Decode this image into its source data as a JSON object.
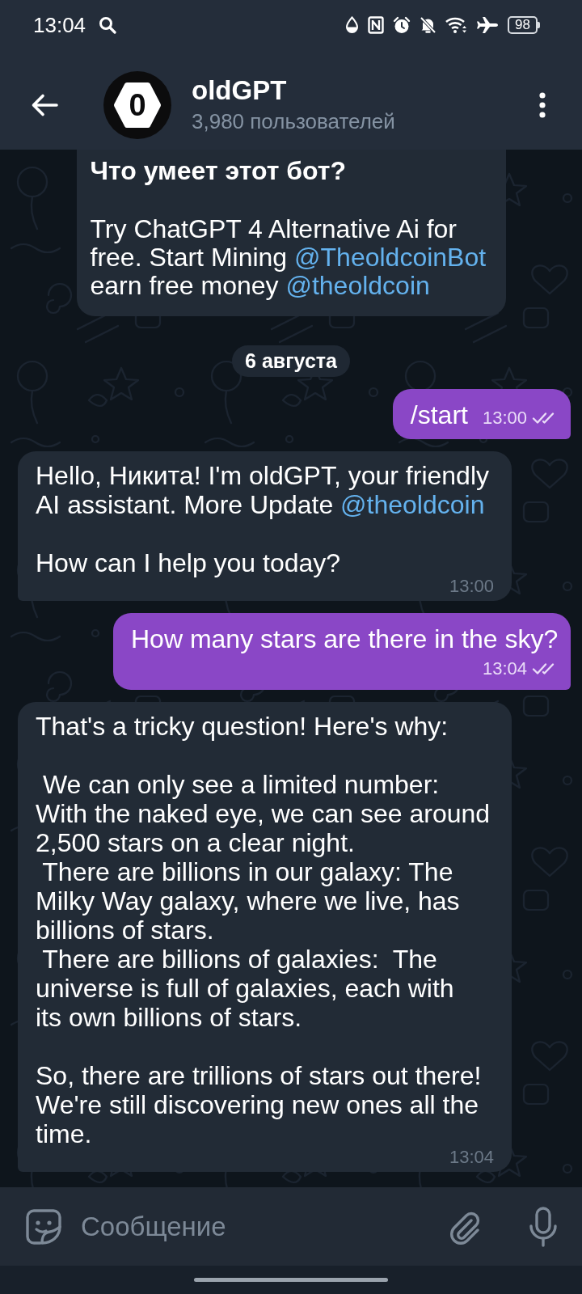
{
  "status_bar": {
    "time": "13:04",
    "battery": "98"
  },
  "header": {
    "logo_text": "0",
    "title": "oldGPT",
    "subtitle": "3,980 пользователей"
  },
  "bot_info": {
    "title": "Что умеет этот бот?",
    "parts": [
      {
        "kind": "text",
        "text": "Try ChatGPT 4 Alternative Ai for\nfree. Start Mining "
      },
      {
        "kind": "link",
        "text": "@TheoldcoinBot"
      },
      {
        "kind": "text",
        "text": "\nearn free money "
      },
      {
        "kind": "link",
        "text": "@theoldcoin"
      }
    ]
  },
  "date_chip": "6 августа",
  "messages": [
    {
      "kind": "outgoing",
      "parts": [
        {
          "kind": "text",
          "text": "/start"
        }
      ],
      "time": "13:00",
      "read": true
    },
    {
      "kind": "incoming",
      "parts": [
        {
          "kind": "text",
          "text": "Hello, Никита! I'm oldGPT, your friendly\nAI assistant. More Update "
        },
        {
          "kind": "link",
          "text": "@theoldcoin"
        },
        {
          "kind": "text",
          "text": "\n\nHow can I help you today?"
        }
      ],
      "time": "13:00"
    },
    {
      "kind": "outgoing",
      "parts": [
        {
          "kind": "text",
          "text": "How many stars are there in the sky?"
        }
      ],
      "time": "13:04",
      "read": true
    },
    {
      "kind": "incoming",
      "parts": [
        {
          "kind": "text",
          "text": "That's a tricky question! Here's why:\n\n We can only see a limited number:\nWith the naked eye, we can see around\n2,500 stars on a clear night.\n There are billions in our galaxy: The\nMilky Way galaxy, where we live, has\nbillions of stars.\n There are billions of galaxies:  The\nuniverse is full of galaxies, each with\nits own billions of stars.\n\nSo, there are trillions of stars out there!\nWe're still discovering new ones all the\ntime."
        }
      ],
      "time": "13:04"
    }
  ],
  "composer": {
    "placeholder": "Сообщение"
  }
}
